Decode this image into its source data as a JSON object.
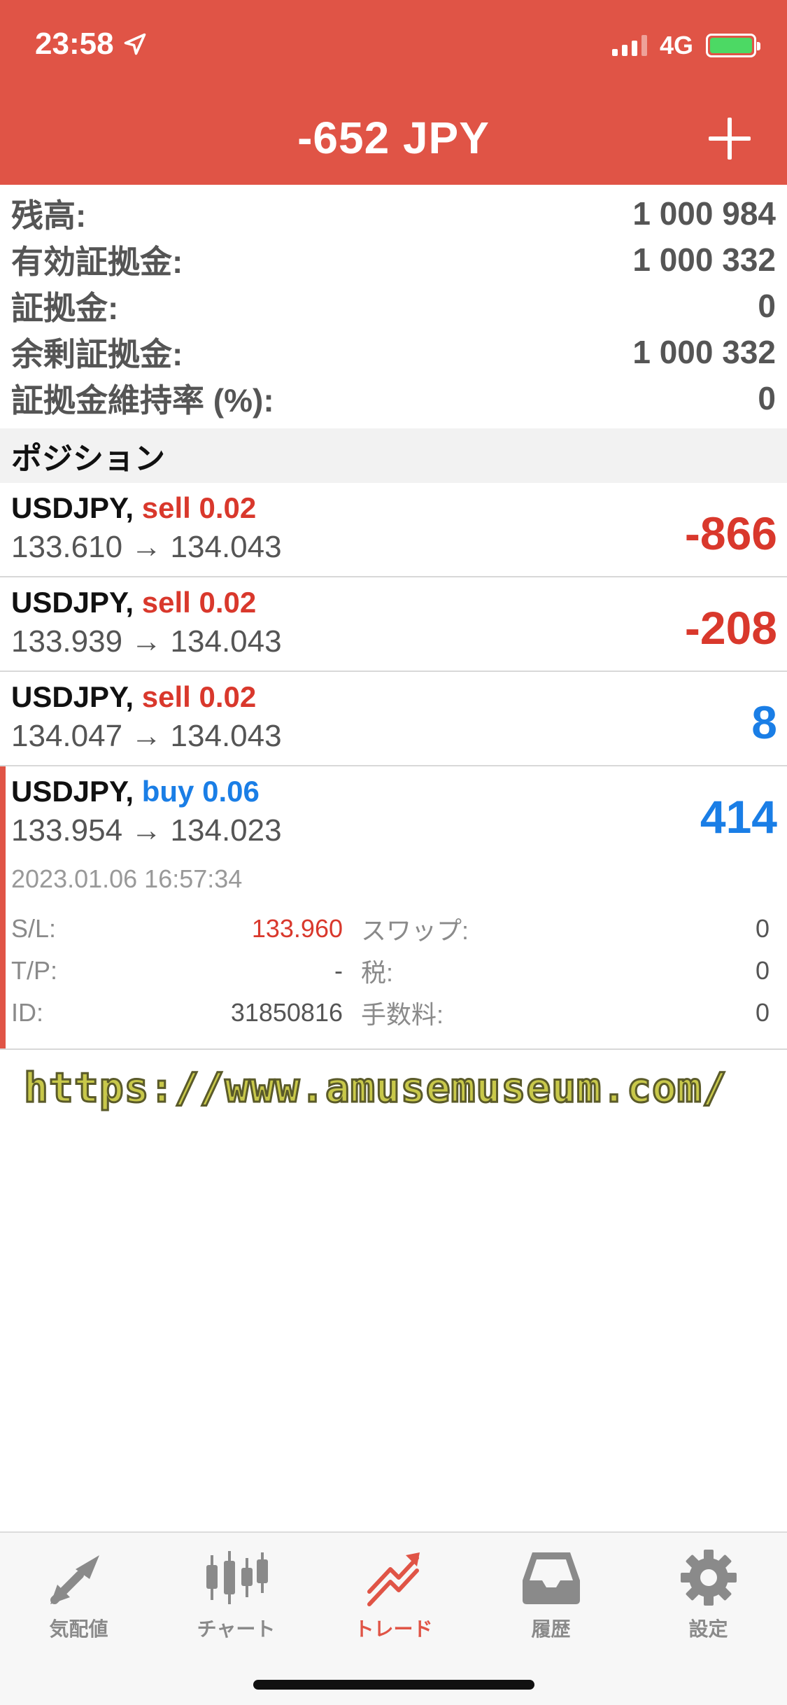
{
  "status_bar": {
    "time": "23:58",
    "network": "4G"
  },
  "header": {
    "title": "-652 JPY"
  },
  "summary": [
    {
      "label": "残高:",
      "value": "1 000 984"
    },
    {
      "label": "有効証拠金:",
      "value": "1 000 332"
    },
    {
      "label": "証拠金:",
      "value": "0"
    },
    {
      "label": "余剰証拠金:",
      "value": "1 000 332"
    },
    {
      "label": "証拠金維持率 (%):",
      "value": "0"
    }
  ],
  "section": {
    "title": "ポジション"
  },
  "positions": [
    {
      "symbol": "USDJPY,",
      "side": "sell 0.02",
      "open": "133.610",
      "arrow": "→",
      "current": "134.043",
      "profit": "-866"
    },
    {
      "symbol": "USDJPY,",
      "side": "sell 0.02",
      "open": "133.939",
      "arrow": "→",
      "current": "134.043",
      "profit": "-208"
    },
    {
      "symbol": "USDJPY,",
      "side": "sell 0.02",
      "open": "134.047",
      "arrow": "→",
      "current": "134.043",
      "profit": "8"
    },
    {
      "symbol": "USDJPY,",
      "side": "buy 0.06",
      "open": "133.954",
      "arrow": "→",
      "current": "134.023",
      "profit": "414",
      "date": "2023.01.06 16:57:34",
      "details": {
        "sl_label": "S/L:",
        "sl_value": "133.960",
        "swap_label": "スワップ:",
        "swap_value": "0",
        "tp_label": "T/P:",
        "tp_value": "-",
        "tax_label": "税:",
        "tax_value": "0",
        "id_label": "ID:",
        "id_value": "31850816",
        "fee_label": "手数料:",
        "fee_value": "0"
      }
    }
  ],
  "watermark": "https://www.amusemuseum.com/",
  "tabs": [
    {
      "label": "気配値",
      "icon": "quotes-icon"
    },
    {
      "label": "チャート",
      "icon": "chart-icon"
    },
    {
      "label": "トレード",
      "icon": "trade-icon",
      "active": true
    },
    {
      "label": "履歴",
      "icon": "history-icon"
    },
    {
      "label": "設定",
      "icon": "settings-icon"
    }
  ],
  "colors": {
    "accent": "#e05446",
    "sell": "#d9382c",
    "buy": "#1a7ee6"
  }
}
